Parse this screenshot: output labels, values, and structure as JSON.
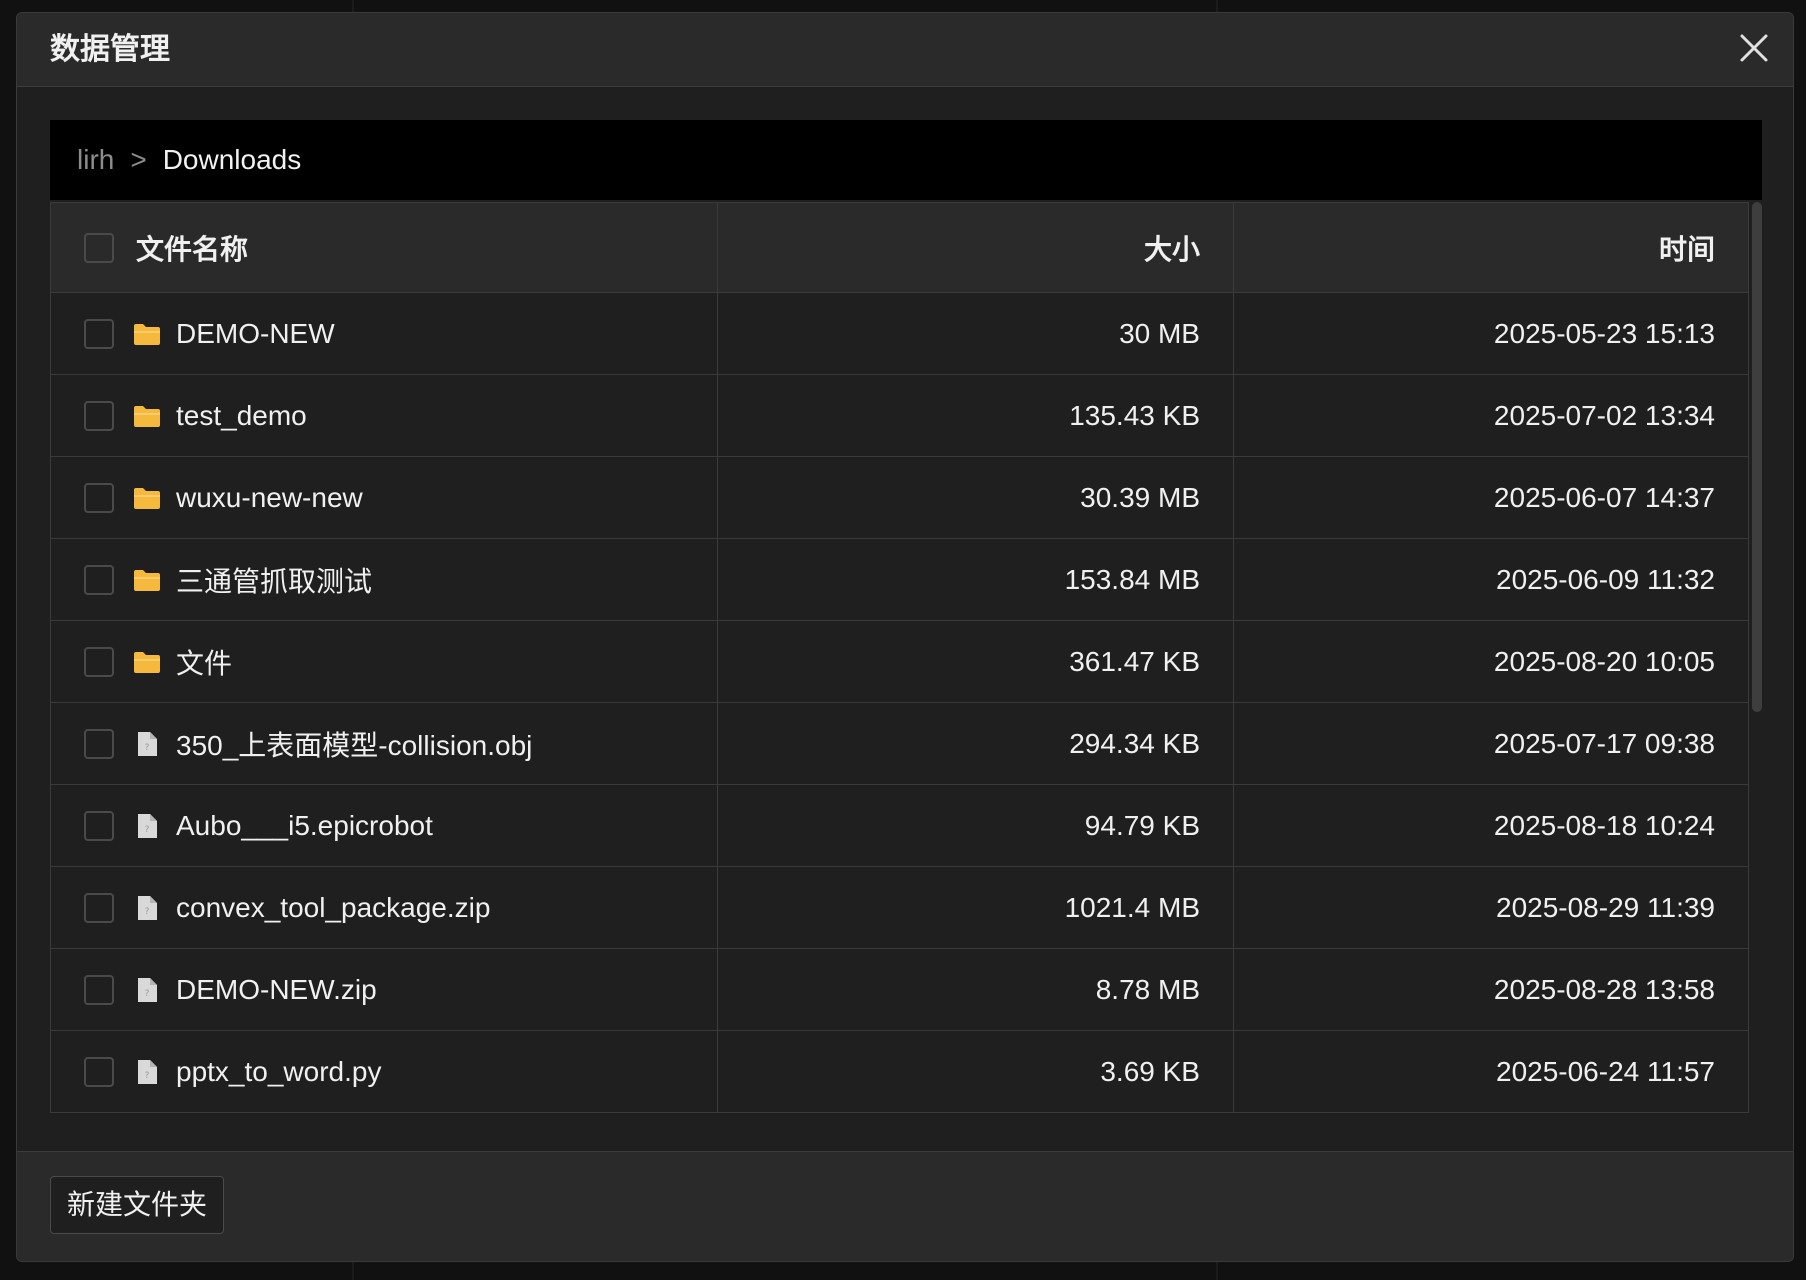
{
  "dialog": {
    "title": "数据管理",
    "close_icon": "close-icon"
  },
  "breadcrumb": {
    "root": "lirh",
    "separator": ">",
    "current": "Downloads"
  },
  "table": {
    "headers": {
      "name": "文件名称",
      "size": "大小",
      "time": "时间"
    },
    "rows": [
      {
        "type": "folder",
        "name": "DEMO-NEW",
        "size": "30 MB",
        "time": "2025-05-23 15:13"
      },
      {
        "type": "folder",
        "name": "test_demo",
        "size": "135.43 KB",
        "time": "2025-07-02 13:34"
      },
      {
        "type": "folder",
        "name": "wuxu-new-new",
        "size": "30.39 MB",
        "time": "2025-06-07 14:37"
      },
      {
        "type": "folder",
        "name": "三通管抓取测试",
        "size": "153.84 MB",
        "time": "2025-06-09 11:32"
      },
      {
        "type": "folder",
        "name": "文件",
        "size": "361.47 KB",
        "time": "2025-08-20 10:05"
      },
      {
        "type": "file",
        "name": "350_上表面模型-collision.obj",
        "size": "294.34 KB",
        "time": "2025-07-17 09:38"
      },
      {
        "type": "file",
        "name": "Aubo___i5.epicrobot",
        "size": "94.79 KB",
        "time": "2025-08-18 10:24"
      },
      {
        "type": "file",
        "name": "convex_tool_package.zip",
        "size": "1021.4 MB",
        "time": "2025-08-29 11:39"
      },
      {
        "type": "file",
        "name": "DEMO-NEW.zip",
        "size": "8.78 MB",
        "time": "2025-08-28 13:58"
      },
      {
        "type": "file",
        "name": "pptx_to_word.py",
        "size": "3.69 KB",
        "time": "2025-06-24 11:57"
      }
    ]
  },
  "footer": {
    "new_folder_label": "新建文件夹"
  },
  "colors": {
    "folder": "#f5b93d",
    "file": "#d9d9d9"
  }
}
